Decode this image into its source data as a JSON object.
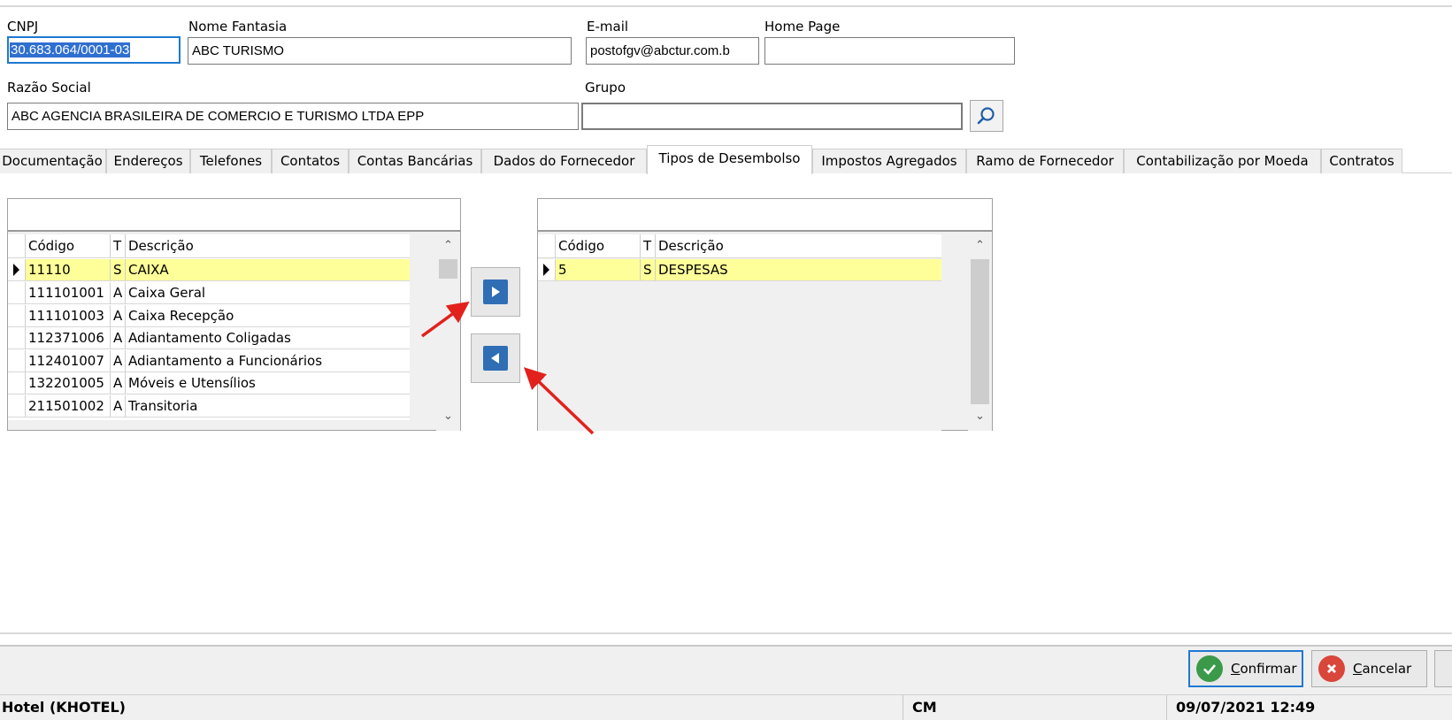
{
  "header": {
    "cnpj_label": "CNPJ",
    "cnpj_value": "30.683.064/0001-03",
    "nome_fantasia_label": "Nome Fantasia",
    "nome_fantasia_value": "ABC TURISMO",
    "email_label": "E-mail",
    "email_value": "postofgv@abctur.com.b",
    "homepage_label": "Home Page",
    "homepage_value": "",
    "razao_social_label": "Razão Social",
    "razao_social_value": "ABC AGENCIA BRASILEIRA DE COMERCIO E TURISMO LTDA EPP",
    "grupo_label": "Grupo",
    "grupo_value": "",
    "search_icon": "magnifier-icon"
  },
  "tabs": [
    {
      "label": "Documentação"
    },
    {
      "label": "Endereços"
    },
    {
      "label": "Telefones"
    },
    {
      "label": "Contatos"
    },
    {
      "label": "Contas Bancárias"
    },
    {
      "label": "Dados do Fornecedor"
    },
    {
      "label": "Tipos de Desembolso"
    },
    {
      "label": "Impostos Agregados"
    },
    {
      "label": "Ramo de Fornecedor"
    },
    {
      "label": "Contabilização por Moeda"
    },
    {
      "label": "Contratos"
    }
  ],
  "active_tab": "Tipos de Desembolso",
  "available": {
    "filter_value": "",
    "columns": {
      "codigo": "Código",
      "t": "T",
      "descricao": "Descrição"
    },
    "rows": [
      {
        "codigo": "11110",
        "t": "S",
        "descricao": "CAIXA"
      },
      {
        "codigo": "111101001",
        "t": "A",
        "descricao": "Caixa Geral"
      },
      {
        "codigo": "111101003",
        "t": "A",
        "descricao": "Caixa Recepção"
      },
      {
        "codigo": "112371006",
        "t": "A",
        "descricao": "Adiantamento Coligadas"
      },
      {
        "codigo": "112401007",
        "t": "A",
        "descricao": "Adiantamento a Funcionários"
      },
      {
        "codigo": "132201005",
        "t": "A",
        "descricao": "Móveis e Utensílios"
      },
      {
        "codigo": "211501002",
        "t": "A",
        "descricao": "Transitoria"
      }
    ]
  },
  "selected": {
    "filter_value": "",
    "columns": {
      "codigo": "Código",
      "t": "T",
      "descricao": "Descrição"
    },
    "rows": [
      {
        "codigo": "5",
        "t": "S",
        "descricao": "DESPESAS"
      }
    ]
  },
  "buttons": {
    "add_icon": "arrow-right-icon",
    "remove_icon": "arrow-left-icon",
    "confirm_first": "C",
    "confirm_rest": "onfirmar",
    "cancel_first": "C",
    "cancel_rest": "ancelar"
  },
  "status": {
    "hotel": "Hotel (KHOTEL)",
    "user": "CM",
    "datetime": "09/07/2021 12:49"
  },
  "colors": {
    "selection_blue": "#2f6fd0",
    "row_highlight": "#ffff99",
    "confirm_green": "#3a9a4a",
    "cancel_red": "#d9463a",
    "annotation_red": "#e3211c"
  }
}
